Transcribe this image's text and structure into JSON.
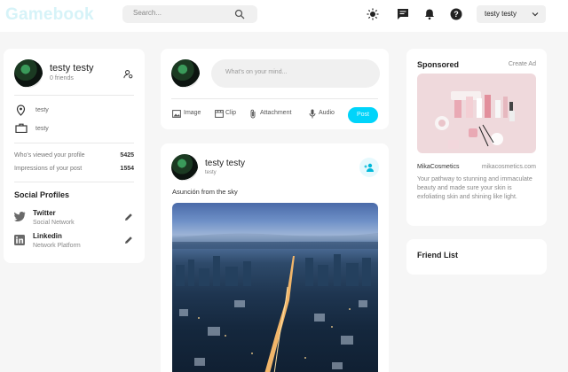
{
  "nav": {
    "logo": "Gamebook",
    "search_placeholder": "Search...",
    "user_name": "testy testy",
    "icons": [
      "search-icon",
      "sun-icon",
      "chat-icon",
      "bell-icon",
      "help-icon",
      "chevron-down-icon"
    ]
  },
  "profile": {
    "name": "testy testy",
    "friends": "0 friends",
    "location": "testy",
    "occupation": "testy",
    "stats": [
      {
        "label": "Who's viewed your profile",
        "value": "5425"
      },
      {
        "label": "Impressions of your post",
        "value": "1554"
      }
    ],
    "social_title": "Social Profiles",
    "socials": [
      {
        "name": "Twitter",
        "type": "Social Network"
      },
      {
        "name": "Linkedin",
        "type": "Network Platform"
      }
    ]
  },
  "composer": {
    "placeholder": "What's on your mind...",
    "actions": [
      "Image",
      "Clip",
      "Attachment",
      "Audio"
    ],
    "post_label": "Post"
  },
  "post": {
    "name": "testy testy",
    "location": "testy",
    "text": "Asunción from the sky"
  },
  "sponsored": {
    "title": "Sponsored",
    "create": "Create Ad",
    "brand": "MikaCosmetics",
    "site": "mikacosmetics.com",
    "description": "Your pathway to stunning and immaculate beauty and made sure your skin is exfoliating skin and shining like light."
  },
  "friends": {
    "title": "Friend List"
  },
  "colors": {
    "accent": "#00d4fa",
    "background": "#f6f6f6",
    "card": "#ffffff"
  }
}
